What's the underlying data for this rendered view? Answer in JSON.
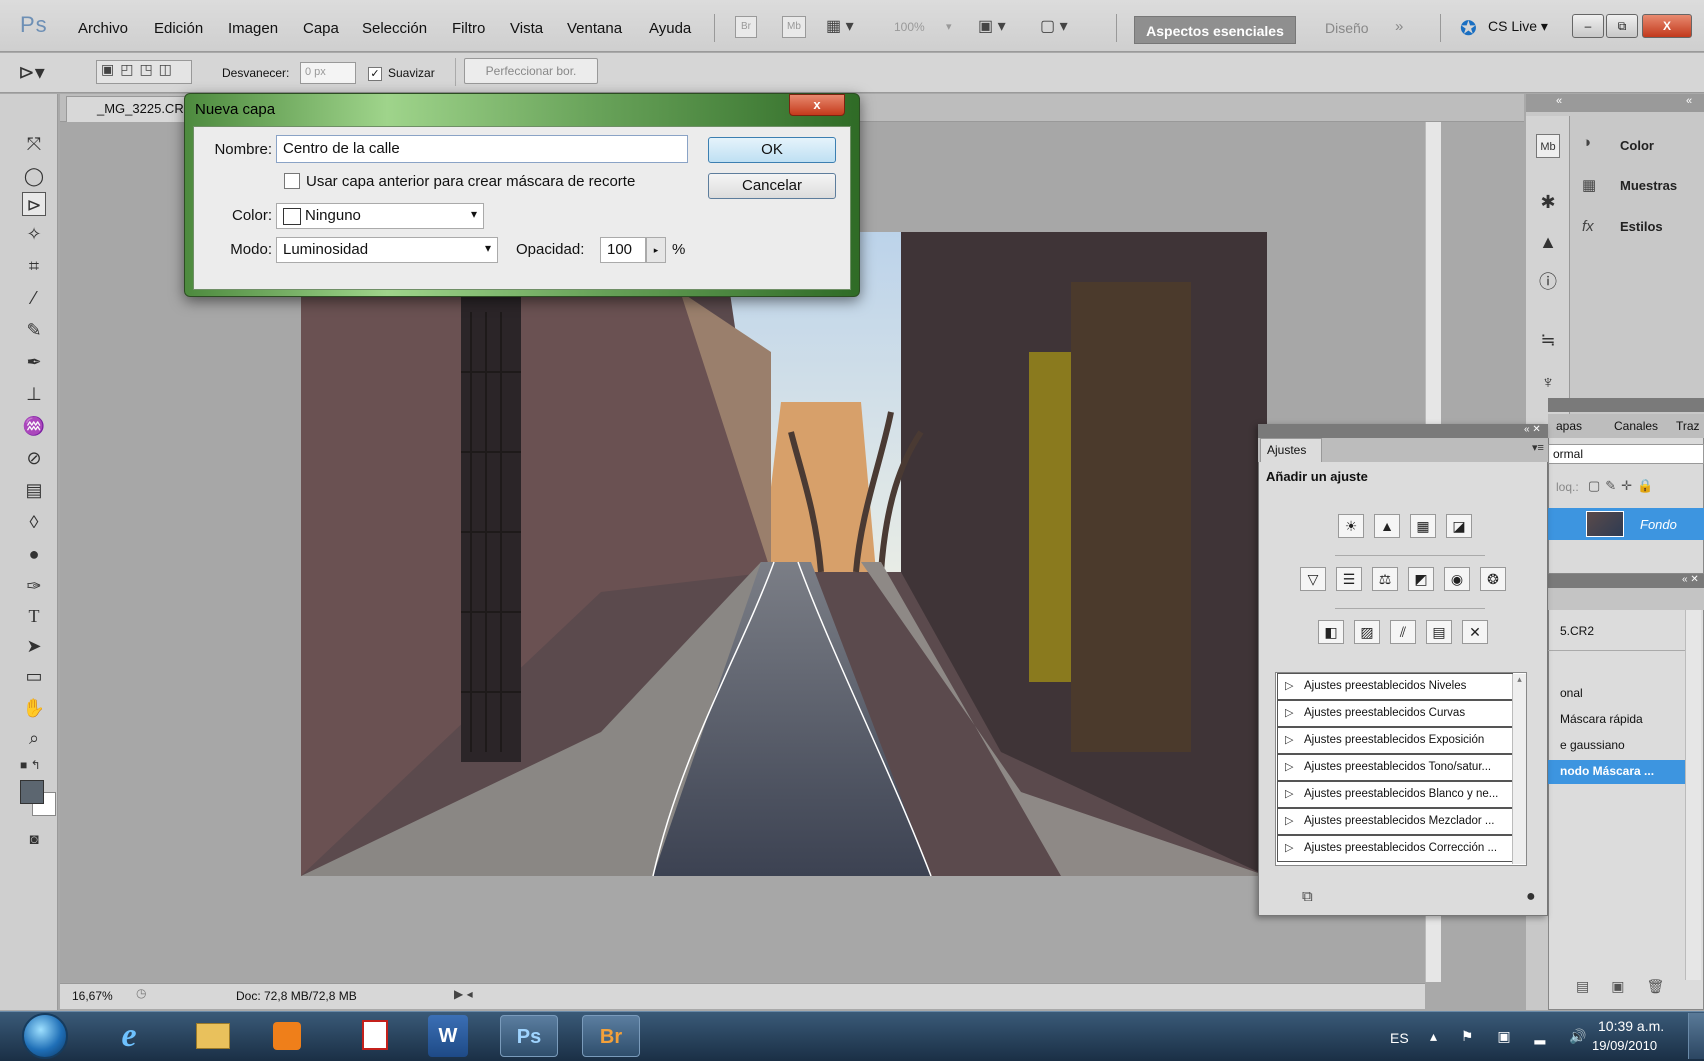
{
  "menubar": {
    "items": [
      "Archivo",
      "Edición",
      "Imagen",
      "Capa",
      "Selección",
      "Filtro",
      "Vista",
      "Ventana",
      "Ayuda"
    ],
    "br": "Br",
    "mb": "Mb",
    "zoom": "100%",
    "workspace_active": "Aspectos esenciales",
    "workspace_other": "Diseño",
    "workspace_more": "»",
    "cs_live": "CS Live ▾",
    "window_min": "–",
    "window_max": "⧉",
    "window_close": "X"
  },
  "options": {
    "feather_label": "Desvanecer:",
    "feather_value": "0 px",
    "antialias_label": "Suavizar",
    "refine_button": "Perfeccionar bor."
  },
  "document": {
    "tab_title": "_MG_3225.CR2",
    "zoom": "16,67%",
    "doc_info": "Doc: 72,8 MB/72,8 MB"
  },
  "dialog": {
    "title": "Nueva capa",
    "name_label": "Nombre:",
    "name_value": "Centro de la calle",
    "clip_label": "Usar capa anterior para crear máscara de recorte",
    "color_label": "Color:",
    "color_value": "Ninguno",
    "mode_label": "Modo:",
    "mode_value": "Luminosidad",
    "opacity_label": "Opacidad:",
    "opacity_value": "100",
    "opacity_unit": "%",
    "ok": "OK",
    "cancel": "Cancelar"
  },
  "right_dock": {
    "color": "Color",
    "swatches": "Muestras",
    "styles": "Estilos"
  },
  "layers": {
    "tabs": [
      "apas",
      "Canales",
      "Traz"
    ],
    "blend": "ormal",
    "lock_label": "loq.:",
    "layer_name": "Fondo"
  },
  "history": {
    "doc": "5.CR2",
    "items": [
      "onal",
      "Máscara rápida",
      "e gaussiano",
      "nodo Máscara ..."
    ]
  },
  "adjustments": {
    "tab": "Ajustes",
    "title": "Añadir un ajuste",
    "presets": [
      "Ajustes preestablecidos Niveles",
      "Ajustes preestablecidos Curvas",
      "Ajustes preestablecidos Exposición",
      "Ajustes preestablecidos Tono/satur...",
      "Ajustes preestablecidos Blanco y ne...",
      "Ajustes preestablecidos Mezclador ...",
      "Ajustes preestablecidos Corrección ..."
    ]
  },
  "taskbar": {
    "lang": "ES",
    "time": "10:39 a.m.",
    "date": "19/09/2010",
    "apps": [
      "e",
      "",
      "",
      "",
      "W",
      "Ps",
      "Br"
    ]
  }
}
